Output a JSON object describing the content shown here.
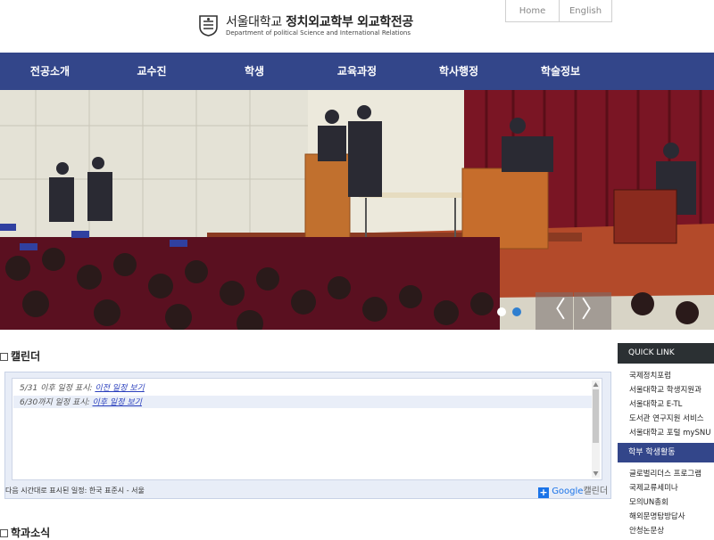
{
  "header": {
    "title_prefix": "서울대학교",
    "title_bold": "정치외교학부 외교학전공",
    "subtitle": "Department of political Science and International Relations",
    "util_links": [
      "Home",
      "English"
    ]
  },
  "nav": {
    "items": [
      "전공소개",
      "교수진",
      "학생",
      "교육과정",
      "학사행정",
      "학술정보"
    ]
  },
  "hero": {
    "prev_symbol": "〈",
    "next_symbol": "〉",
    "slide_count": 2,
    "active_slide": 1
  },
  "calendar": {
    "title": "캘린더",
    "lines": [
      {
        "text": "5/31 이후 일정 표시: ",
        "link": "이전 일정 보기"
      },
      {
        "text": "6/30까지 일정 표시: ",
        "link": "이후 일정 보기"
      }
    ],
    "footer": "다음 시간대로 표시된 일정: 한국 표준시 - 서울",
    "google_label": "Google",
    "google_suffix": "캘린더"
  },
  "news": {
    "title": "학과소식"
  },
  "quick_link": {
    "title": "QUICK LINK",
    "items": [
      "국제정치포럼",
      "서울대학교 학생지원과",
      "서울대학교 E-TL",
      "도서관 연구지원 서비스",
      "서울대학교 포털 mySNU"
    ],
    "section_title": "학부 학생활동",
    "section_items": [
      "글로벌리더스 프로그램",
      "국제교류세미나",
      "모의UN총회",
      "해외문명탐방답사",
      "안청논문상"
    ]
  },
  "colors": {
    "nav_bg": "#33468a",
    "quick_link_head": "#2b3033",
    "link": "#2a3fbd"
  }
}
